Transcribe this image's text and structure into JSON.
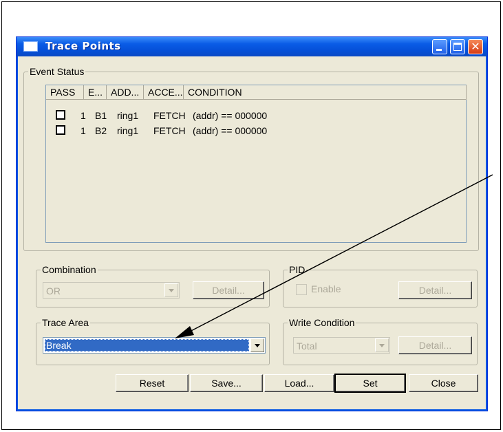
{
  "window": {
    "title": "Trace Points"
  },
  "event_status": {
    "label": "Event Status",
    "columns": [
      "PASS",
      "E...",
      "ADD...",
      "ACCE...",
      "CONDITION"
    ],
    "rows": [
      {
        "pass": "1",
        "event": "B1",
        "address": "ring1",
        "access": "FETCH",
        "condition": "(addr) == 000000"
      },
      {
        "pass": "1",
        "event": "B2",
        "address": "ring1",
        "access": "FETCH",
        "condition": "(addr) == 000000"
      }
    ]
  },
  "combination": {
    "label": "Combination",
    "value": "OR",
    "detail_label": "Detail..."
  },
  "pid": {
    "label": "PID",
    "enable_label": "Enable",
    "detail_label": "Detail..."
  },
  "trace_area": {
    "label": "Trace Area",
    "value": "Break"
  },
  "write_condition": {
    "label": "Write Condition",
    "value": "Total",
    "detail_label": "Detail..."
  },
  "buttons": {
    "reset": "Reset",
    "save": "Save...",
    "load": "Load...",
    "set": "Set",
    "close": "Close"
  },
  "colors": {
    "titlebar": "#0a5ce6",
    "dialog_bg": "#ece9d8",
    "selection": "#316ac5",
    "close_button": "#d63a12"
  }
}
